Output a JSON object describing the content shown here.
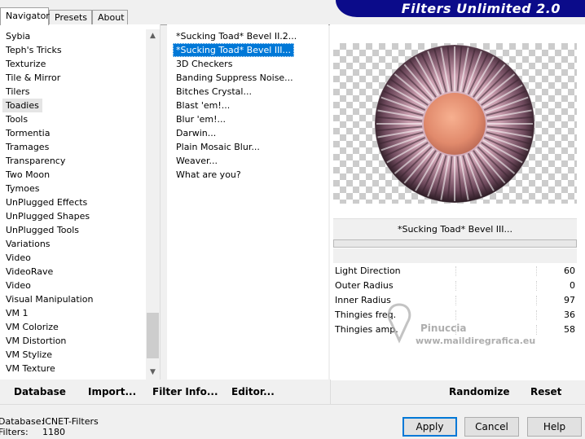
{
  "tabs": [
    "Navigator",
    "Presets",
    "About"
  ],
  "title": "Filters Unlimited 2.0",
  "categories": [
    "Sybia",
    "Teph's Tricks",
    "Texturize",
    "Tile & Mirror",
    "Tilers",
    "Toadies",
    "Tools",
    "Tormentia",
    "Tramages",
    "Transparency",
    "Two Moon",
    "Tymoes",
    "UnPlugged Effects",
    "UnPlugged Shapes",
    "UnPlugged Tools",
    "Variations",
    "Video",
    "VideoRave",
    "Video",
    "Visual Manipulation",
    "VM 1",
    "VM Colorize",
    "VM Distortion",
    "VM Stylize",
    "VM Texture"
  ],
  "selected_category": "Toadies",
  "filters": [
    "*Sucking Toad*  Bevel II.2...",
    "*Sucking Toad*  Bevel III...",
    "3D Checkers",
    "Banding Suppress Noise...",
    "Bitches Crystal...",
    "Blast 'em!...",
    "Blur 'em!...",
    "Darwin...",
    "Plain Mosaic Blur...",
    "Weaver...",
    "What are you?"
  ],
  "selected_filter": "*Sucking Toad*  Bevel III...",
  "preview": {
    "current_filter": "*Sucking Toad*  Bevel III..."
  },
  "params": [
    {
      "label": "Light Direction",
      "value": "60"
    },
    {
      "label": "Outer Radius",
      "value": "0"
    },
    {
      "label": "Inner Radius",
      "value": "97"
    },
    {
      "label": "Thingies freq.",
      "value": "36"
    },
    {
      "label": "Thingies amp.",
      "value": "58"
    }
  ],
  "commands": {
    "database": "Database",
    "import": "Import...",
    "filter_info": "Filter Info...",
    "editor": "Editor...",
    "randomize": "Randomize",
    "reset": "Reset"
  },
  "status": {
    "database_label": "Database:",
    "database_value": "ICNET-Filters",
    "filters_label": "Filters:",
    "filters_value": "1180"
  },
  "buttons": {
    "apply": "Apply",
    "cancel": "Cancel",
    "help": "Help"
  },
  "watermark": {
    "line1": "Pinuccia",
    "line2": "www.maildiregrafica.eu"
  },
  "colors": {
    "selection": "#0078d7",
    "banner": "#0b0b8a"
  }
}
